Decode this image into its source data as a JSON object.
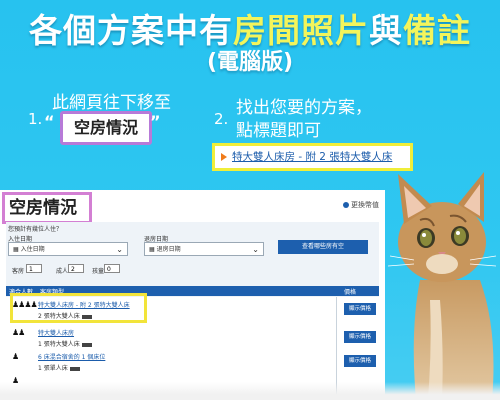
{
  "heading": {
    "line1_part1": "各個方案中有",
    "line1_highlight1": "房間照片",
    "line1_part2": "與",
    "line1_highlight2": "備註",
    "line2": "(電腦版)"
  },
  "step1": {
    "number": "1.",
    "text_line1": "此網頁往下移至",
    "quote_open": "“",
    "boxed_text": "空房情況",
    "quote_close": "”"
  },
  "step2": {
    "number": "2.",
    "text_line1": "找出您要的方案，",
    "text_line2": "點標題即可",
    "link_text": "特大雙人床房 - 附 2 張特大雙人床"
  },
  "screenshot": {
    "title": "空房情況",
    "currency_label": "更換幣值",
    "question": "您預計有幾位人住？",
    "checkin_label": "入住日期",
    "checkin_value": "入住日期",
    "checkout_label": "退房日期",
    "checkout_value": "退房日期",
    "search_button": "查看哪些房有空",
    "rooms_label": "客房",
    "rooms_value": "1",
    "adults_label": "成人",
    "adults_value": "2",
    "children_label": "孩童",
    "children_value": "0",
    "table_headers": [
      "適合人數",
      "客房類型",
      "價格"
    ],
    "rows": [
      {
        "persons": "♟♟♟♟",
        "link": "特大雙人床房 - 附 2 張特大雙人床",
        "sub": "2 張特大雙人床",
        "button": "顯示價格"
      },
      {
        "persons": "♟♟",
        "link": "特大雙人床房",
        "sub": "1 張特大雙人床",
        "button": "顯示價格"
      },
      {
        "persons": "♟",
        "link": "6 床混合宿舍的 1 個床位",
        "sub": "1 張單人床",
        "button": "顯示價格"
      },
      {
        "persons": "♟",
        "link": "",
        "sub": "",
        "button": ""
      }
    ]
  },
  "colors": {
    "background": "#2fc7f1",
    "highlight_text": "#f3f55b",
    "purple_box": "#b77ad8",
    "yellow_box": "#f0ee39",
    "link": "#1b5cab",
    "button": "#1d5fae"
  }
}
